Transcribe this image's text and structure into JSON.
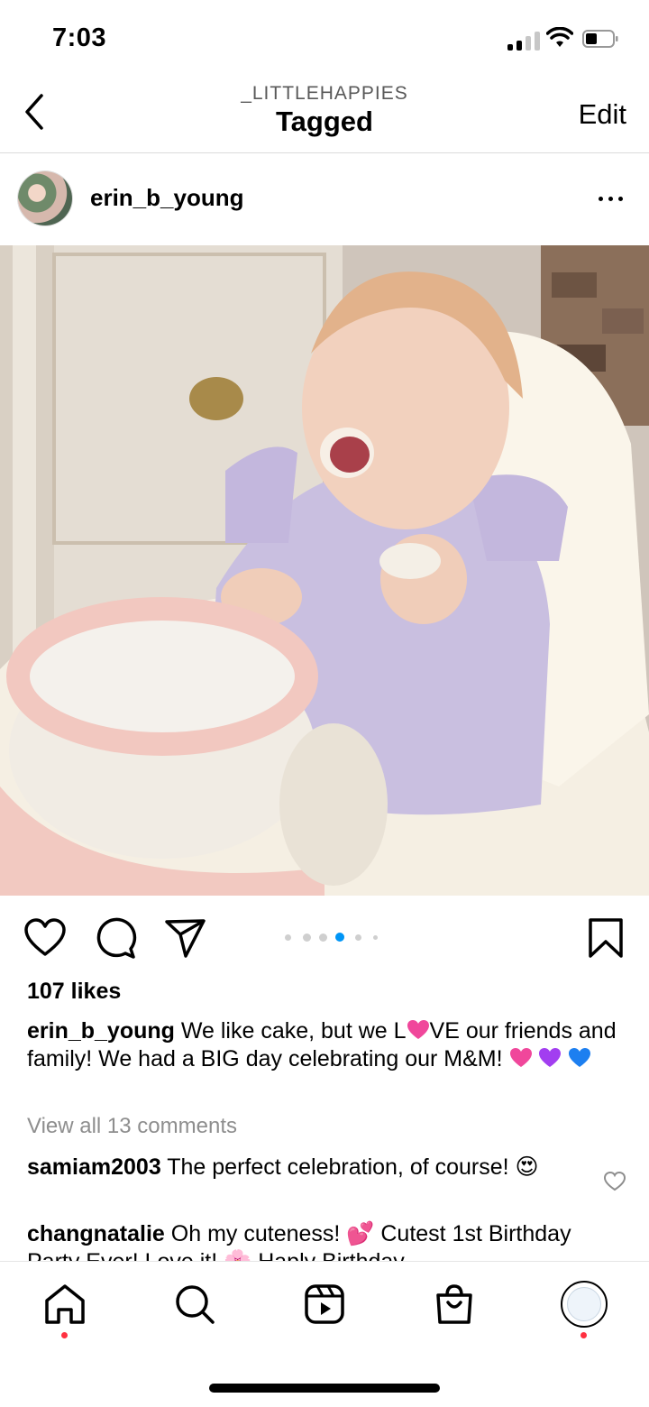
{
  "status_bar": {
    "time": "7:03"
  },
  "header": {
    "subtitle": "_LITTLEHAPPIES",
    "title": "Tagged",
    "edit_label": "Edit"
  },
  "post": {
    "username": "erin_b_young",
    "likes": "107 likes",
    "caption_user": "erin_b_young",
    "caption_part1": "We like cake, but we L",
    "caption_part2": "VE our friends and family! We had a BIG day celebrating our M&M!",
    "view_all": "View all 13 comments",
    "carousel": {
      "count": 6,
      "active_index": 3
    }
  },
  "comments": [
    {
      "user": "samiam2003",
      "text": "The perfect celebration, of course! 😍"
    },
    {
      "user": "changnatalie",
      "text": "Oh my cuteness! 💕 Cutest 1st Birthday Party Ever! Love it! 🌸 Haply Birthday"
    }
  ],
  "colors": {
    "notification_dot": "#ff3040",
    "active_dot": "#0095f6",
    "muted_text": "#8e8e8e"
  },
  "icons": [
    "back-icon",
    "more-icon",
    "heart-icon",
    "comment-icon",
    "share-icon",
    "bookmark-icon",
    "home-icon",
    "search-icon",
    "reels-icon",
    "shop-icon",
    "profile-icon"
  ]
}
